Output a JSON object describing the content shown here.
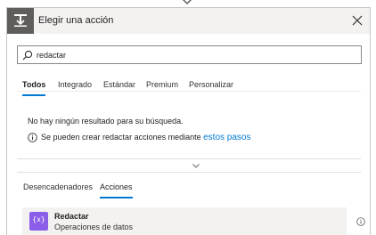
{
  "dialog": {
    "title": "Elegir una acción",
    "header_icon": "trigger-action-icon",
    "close_icon": "close-icon"
  },
  "search": {
    "value": "redactar",
    "icon": "search-icon"
  },
  "top_tabs": [
    {
      "label": "Todos",
      "active": true
    },
    {
      "label": "Integrado",
      "active": false
    },
    {
      "label": "Estándar",
      "active": false
    },
    {
      "label": "Premium",
      "active": false
    },
    {
      "label": "Personalizar",
      "active": false
    }
  ],
  "results": {
    "no_results": "No hay ningún resultado para su búsqueda.",
    "info_text": "Se pueden crear redactar acciones mediante",
    "info_link": "estos pasos",
    "info_icon": "info-icon"
  },
  "expander_icon": "chevron-down-icon",
  "bottom_tabs": [
    {
      "label": "Desencadenadores",
      "active": false
    },
    {
      "label": "Acciones",
      "active": true
    }
  ],
  "action": {
    "title": "Redactar",
    "subtitle": "Operaciones de datos",
    "icon": "data-operation-icon",
    "icon_glyph": "{x}",
    "icon_color": "#8a5ee8",
    "info_icon": "info-icon"
  },
  "colors": {
    "accent": "#0078d4",
    "header_bg": "#f3f2f1",
    "header_icon_bg": "#605e5c"
  }
}
